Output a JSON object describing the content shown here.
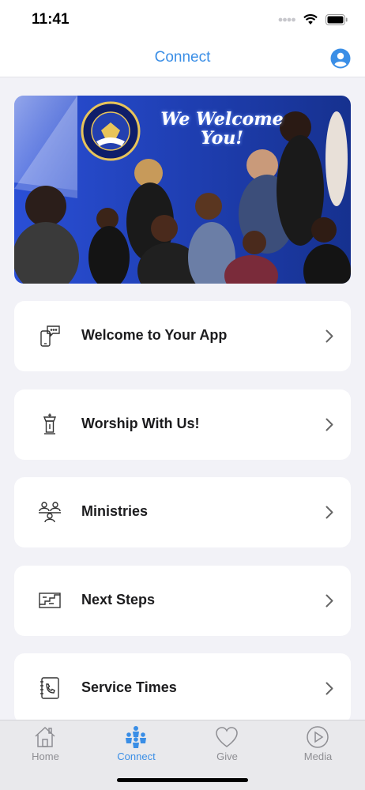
{
  "status_bar": {
    "time": "11:41"
  },
  "nav": {
    "title": "Connect"
  },
  "banner": {
    "headline": "We Welcome You!",
    "logo_text": "EMBASSY LIFE",
    "logo_subtext": "INTERNATIONAL MINISTRIES"
  },
  "menu": [
    {
      "label": "Welcome to Your App",
      "icon": "phone-chat-icon"
    },
    {
      "label": "Worship With Us!",
      "icon": "pulpit-icon"
    },
    {
      "label": "Ministries",
      "icon": "people-group-icon"
    },
    {
      "label": "Next Steps",
      "icon": "steps-icon"
    },
    {
      "label": "Service Times",
      "icon": "phone-book-icon"
    }
  ],
  "tabs": [
    {
      "label": "Home",
      "icon": "home-icon"
    },
    {
      "label": "Connect",
      "icon": "group-icon",
      "active": true
    },
    {
      "label": "Give",
      "icon": "heart-icon"
    },
    {
      "label": "Media",
      "icon": "play-icon"
    }
  ],
  "colors": {
    "accent": "#3a8ee6",
    "background": "#f2f2f7",
    "banner_blue": "#1f3fb3"
  }
}
